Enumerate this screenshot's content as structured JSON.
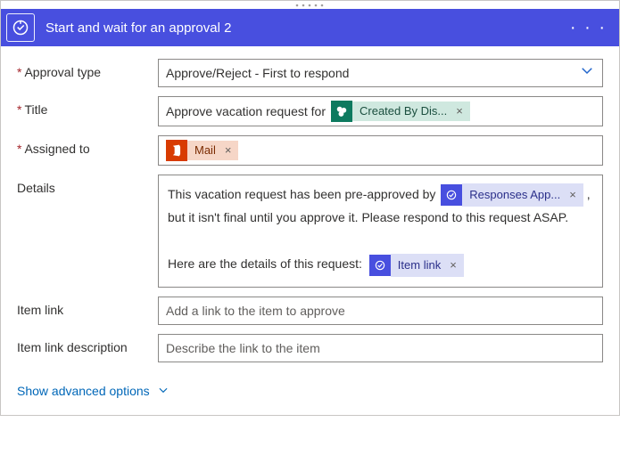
{
  "header": {
    "title": "Start and wait for an approval 2"
  },
  "labels": {
    "approval_type": "Approval type",
    "title": "Title",
    "assigned_to": "Assigned to",
    "details": "Details",
    "item_link": "Item link",
    "item_link_description": "Item link description"
  },
  "approval_type": {
    "value": "Approve/Reject - First to respond"
  },
  "title_field": {
    "text_prefix": "Approve vacation request for",
    "token": {
      "label": "Created By Dis..."
    }
  },
  "assigned_to": {
    "token": {
      "label": "Mail"
    }
  },
  "details": {
    "line1_prefix": "This vacation request has been pre-approved by",
    "token_responses": {
      "label": "Responses App..."
    },
    "line1_suffix": ",",
    "line2": "but it isn't final until you approve it. Please respond to this request ASAP.",
    "line3_prefix": "Here are the details of this request:",
    "token_item_link": {
      "label": "Item link"
    }
  },
  "item_link": {
    "placeholder": "Add a link to the item to approve"
  },
  "item_link_description": {
    "placeholder": "Describe the link to the item"
  },
  "advanced": {
    "label": "Show advanced options"
  }
}
